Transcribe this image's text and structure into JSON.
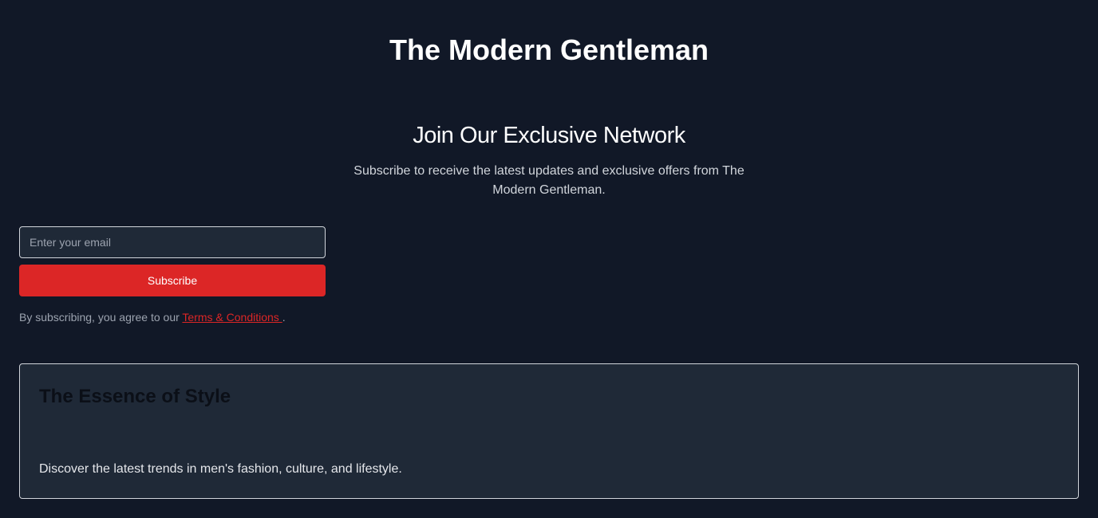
{
  "header": {
    "title": "The Modern Gentleman"
  },
  "signup": {
    "heading": "Join Our Exclusive Network",
    "description": "Subscribe to receive the latest updates and exclusive offers from The Modern Gentleman.",
    "email_placeholder": "Enter your email",
    "email_value": "",
    "subscribe_label": "Subscribe",
    "terms_prefix": "By subscribing, you agree to our ",
    "terms_link": "Terms & Conditions ",
    "terms_suffix": "."
  },
  "feature": {
    "title": "The Essence of Style",
    "description": "Discover the latest trends in men's fashion, culture, and lifestyle."
  },
  "colors": {
    "background": "#111827",
    "card_background": "#1f2937",
    "accent": "#dc2626",
    "border": "#d1d5db"
  }
}
